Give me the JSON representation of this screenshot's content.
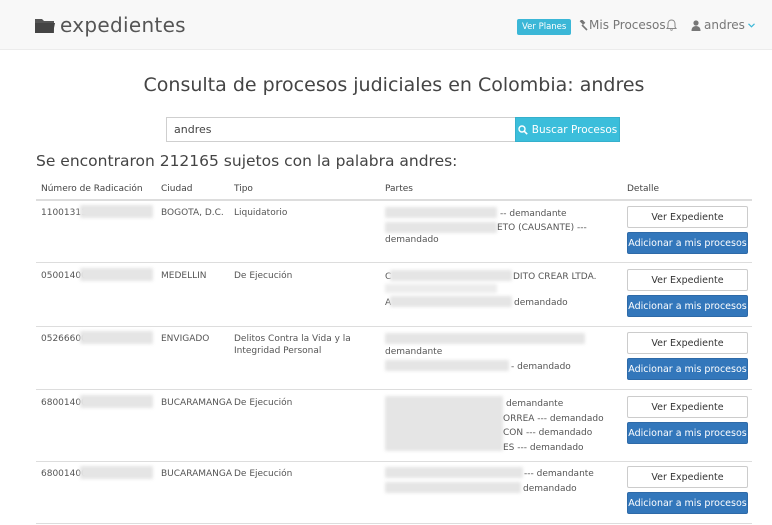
{
  "nav": {
    "brand": "expedientes",
    "plans_label": "Ver Planes",
    "my_processes_label": "Mis Procesos",
    "user_label": "andres"
  },
  "page": {
    "title": "Consulta de procesos judiciales en Colombia: andres",
    "search_value": "andres",
    "search_button_label": "Buscar Procesos",
    "results_title": "Se encontraron 212165 sujetos con la palabra andres:"
  },
  "table": {
    "headers": [
      "Número de Radicación",
      "Ciudad",
      "Tipo",
      "Partes",
      "Detalle"
    ],
    "view_label": "Ver Expediente",
    "add_label": "Adicionar a mis procesos",
    "rows": [
      {
        "radicacion": "11001311",
        "ciudad": "BOGOTA, D.C.",
        "tipo": "Liquidatorio",
        "partes": [
          "-- demandante",
          "ETO (CAUSANTE) ---",
          "demandado"
        ]
      },
      {
        "radicacion": "05001400",
        "ciudad": "MEDELLIN",
        "tipo": "De Ejecución",
        "partes": [
          "C",
          "DITO CREAR LTDA.",
          "A",
          "demandado"
        ]
      },
      {
        "radicacion": "05266600",
        "ciudad": "ENVIGADO",
        "tipo": "Delitos Contra la Vida y la Integridad Personal",
        "partes": [
          "demandante",
          "- demandado"
        ]
      },
      {
        "radicacion": "68001400",
        "ciudad": "BUCARAMANGA",
        "tipo": "De Ejecución",
        "partes": [
          "demandante",
          "ORREA --- demandado",
          "CON --- demandado",
          "ES --- demandado"
        ]
      },
      {
        "radicacion": "68001400",
        "ciudad": "BUCARAMANGA",
        "tipo": "De Ejecución",
        "partes": [
          "--- demandante",
          "demandado"
        ]
      }
    ]
  },
  "colors": {
    "navbar_bg": "#f8f8f8",
    "info_button": "#3bb7d7",
    "primary_button": "#3377bb"
  }
}
